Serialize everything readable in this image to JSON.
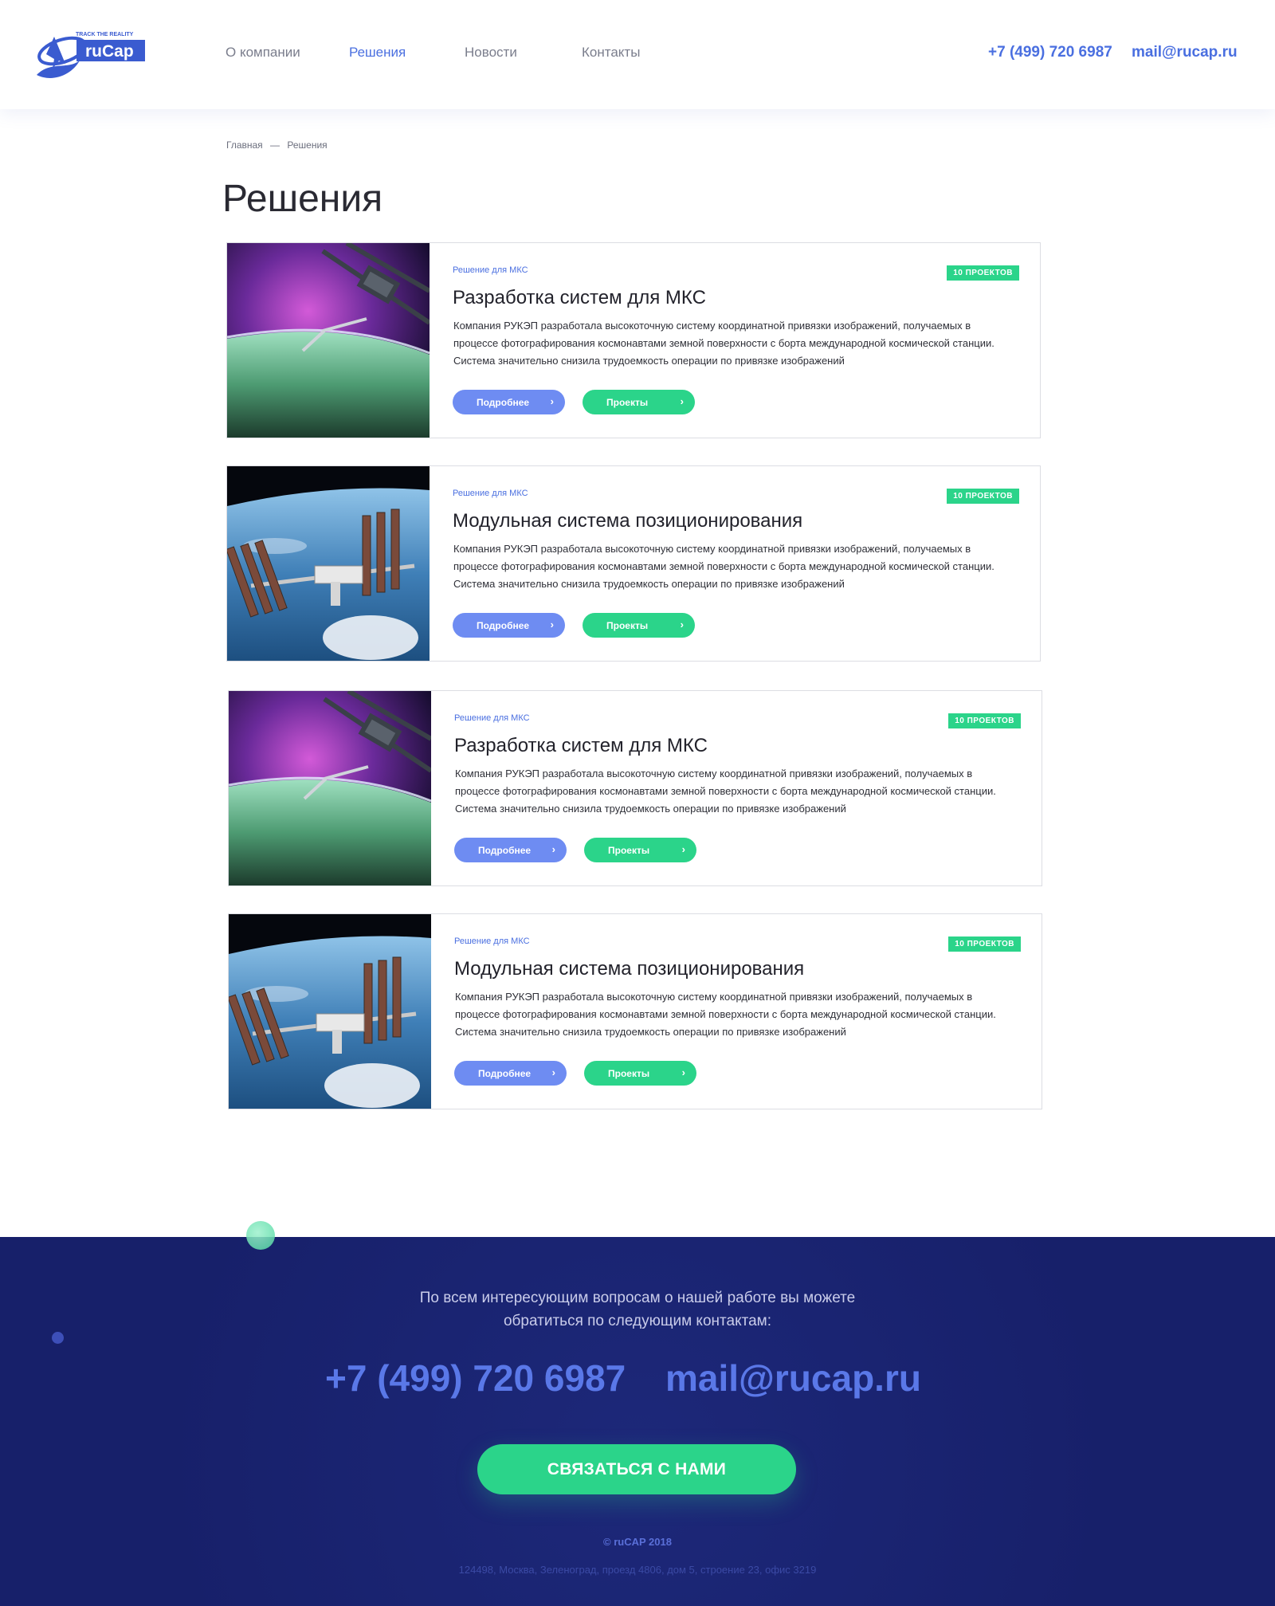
{
  "header": {
    "logo_tagline": "TRACK THE REALITY",
    "logo_text": "ruCap",
    "nav": [
      {
        "label": "О компании"
      },
      {
        "label": "Решения"
      },
      {
        "label": "Новости"
      },
      {
        "label": "Контакты"
      }
    ],
    "active_nav": "Решения",
    "phone": "+7 (499) 720 6987",
    "email": "mail@rucap.ru"
  },
  "breadcrumb": {
    "home": "Главная",
    "separator": "—",
    "current": "Решения"
  },
  "page_title": "Решения",
  "cards": [
    {
      "image": "space-station-aurora",
      "tag": "Решение для МКС",
      "badge": "10 ПРОЕКТОВ",
      "title": "Разработка систем для МКС",
      "description": "Компания РУКЭП разработала высокоточную систему координатной привязки изображений, получаемых в процессе фотографирования космонавтами земной поверхности с борта международной космической станции. Система значительно снизила трудоемкость операции по привязке изображений",
      "more_label": "Подробнее",
      "projects_label": "Проекты"
    },
    {
      "image": "iss-over-earth",
      "tag": "Решение для МКС",
      "badge": "10 ПРОЕКТОВ",
      "title": "Модульная система позиционирования",
      "description": "Компания РУКЭП разработала высокоточную систему координатной привязки изображений, получаемых в процессе фотографирования космонавтами земной поверхности с борта международной космической станции. Система значительно снизила трудоемкость операции по привязке изображений",
      "more_label": "Подробнее",
      "projects_label": "Проекты"
    },
    {
      "image": "space-station-aurora",
      "tag": "Решение для МКС",
      "badge": "10 ПРОЕКТОВ",
      "title": "Разработка систем для МКС",
      "description": "Компания РУКЭП разработала высокоточную систему координатной привязки изображений, получаемых в процессе фотографирования космонавтами земной поверхности с борта международной космической станции. Система значительно снизила трудоемкость операции по привязке изображений",
      "more_label": "Подробнее",
      "projects_label": "Проекты"
    },
    {
      "image": "iss-over-earth",
      "tag": "Решение для МКС",
      "badge": "10 ПРОЕКТОВ",
      "title": "Модульная система позиционирования",
      "description": "Компания РУКЭП разработала высокоточную систему координатной привязки изображений, получаемых в процессе фотографирования космонавтами земной поверхности с борта международной космической станции. Система значительно снизила трудоемкость операции по привязке изображений",
      "more_label": "Подробнее",
      "projects_label": "Проекты"
    }
  ],
  "footer": {
    "text_line1": "По всем интересующим вопросам о нашей работе вы можете",
    "text_line2": "обратиться по следующим контактам:",
    "phone": "+7 (499) 720 6987",
    "email": "mail@rucap.ru",
    "button": "СВЯЗАТЬСЯ С НАМИ",
    "copyright": "© ruCAP 2018",
    "address": "124498, Москва, Зеленоград, проезд 4806, дом 5, строение 23, офис 3219"
  },
  "colors": {
    "accent_blue": "#4a6fe0",
    "button_blue": "#6e8cf2",
    "accent_green": "#2bd48a",
    "footer_bg": "#17206a"
  }
}
